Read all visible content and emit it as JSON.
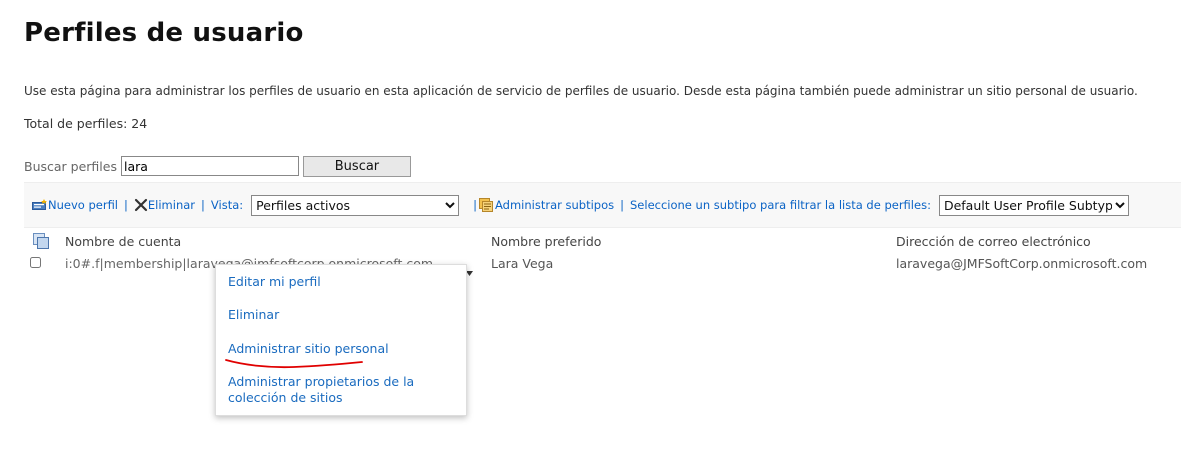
{
  "page": {
    "title": "Perfiles de usuario",
    "description": "Use esta página para administrar los perfiles de usuario en esta aplicación de servicio de perfiles de usuario. Desde esta página también puede administrar un sitio personal de usuario.",
    "total_label": "Total de perfiles:",
    "total_count": "24"
  },
  "search": {
    "label": "Buscar perfiles",
    "value": "lara",
    "button_label": "Buscar"
  },
  "toolbar": {
    "new_profile": "Nuevo perfil",
    "delete": "Eliminar",
    "view_label": "Vista:",
    "view_selected": "Perfiles activos",
    "manage_subtypes": "Administrar subtipos",
    "subtype_filter_label": "Seleccione un subtipo para filtrar la lista de perfiles:",
    "subtype_selected": "Default User Profile Subtype",
    "separator": "|"
  },
  "table": {
    "headers": {
      "account": "Nombre de cuenta",
      "preferred": "Nombre preferido",
      "email": "Dirección de correo electrónico"
    },
    "rows": [
      {
        "account": "i:0#.f|membership|laravega@jmfsoftcorp.onmicrosoft.com",
        "preferred": "Lara Vega",
        "email": "laravega@JMFSoftCorp.onmicrosoft.com"
      }
    ]
  },
  "context_menu": {
    "items": [
      "Editar mi perfil",
      "Eliminar",
      "Administrar sitio personal",
      "Administrar propietarios de la colección de sitios"
    ]
  },
  "colors": {
    "link": "#0b63c5",
    "annotation": "#e00000",
    "toolbar_bg": "#f8f8f8"
  },
  "icons": [
    "new-profile-icon",
    "delete-x-icon",
    "manage-subtypes-icon",
    "select-all-icon",
    "dropdown-arrow-icon"
  ]
}
